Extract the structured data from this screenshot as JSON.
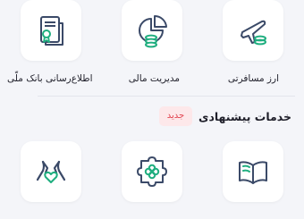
{
  "services_row": [
    {
      "label": "ارز مسافرتی",
      "icon": "airplane-coins-icon"
    },
    {
      "label": "مدیریت مالی",
      "icon": "pie-chart-coins-icon"
    },
    {
      "label": "اطلاع‌رسانی بانک ملّی",
      "icon": "document-badge-icon"
    }
  ],
  "suggested_section": {
    "title": "خدمات پیشنهادی",
    "badge": "جدید",
    "items": [
      {
        "label": "...",
        "icon": "open-book-icon"
      },
      {
        "label": "...",
        "icon": "puzzle-clover-icon"
      },
      {
        "label": "...",
        "icon": "hands-heart-icon"
      }
    ]
  },
  "colors": {
    "icon_dark": "#3b4a68",
    "icon_accent": "#1fae7f",
    "badge_bg": "#fde8ea",
    "badge_text": "#e2434f",
    "background": "#f4f5f9"
  }
}
